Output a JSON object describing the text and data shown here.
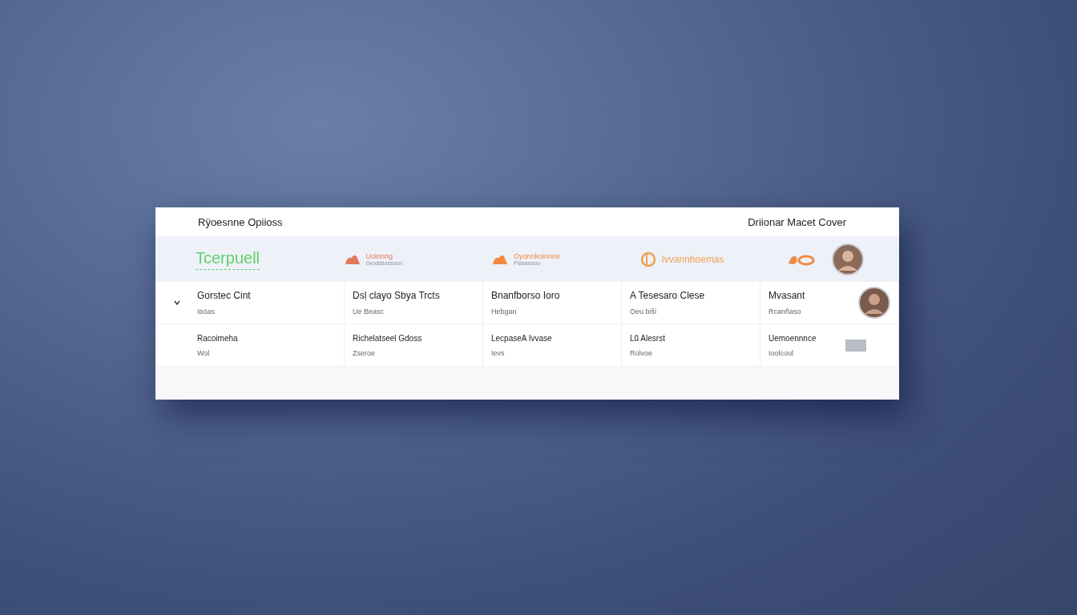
{
  "header": {
    "title": "Rÿoesnne Opiioss",
    "right_title": "Driionar Macet Cover"
  },
  "logos": [
    {
      "kind": "wordmark",
      "name": "Tcerpuell",
      "color": "#5fd06a"
    },
    {
      "kind": "icon_text",
      "name": "Uoinnng",
      "tagline": "Grodsbossoon",
      "color": "#e07a5a"
    },
    {
      "kind": "icon_text",
      "name": "Oyonnkoinnne",
      "tagline": "Piseanooo",
      "color": "#f08a40"
    },
    {
      "kind": "ring_text",
      "name": "Ivvannhoemas",
      "color": "#f0a050"
    },
    {
      "kind": "mark",
      "color": "#f08a40"
    }
  ],
  "rows": [
    {
      "expanded": true,
      "cells": [
        {
          "title": "Gorstec Cint",
          "subtitle": "Iɒöas"
        },
        {
          "title": "Dsḷ clayo Sbya Trcts",
          "subtitle": "Ue Beasc"
        },
        {
          "title": "Bnanfborso Ioro",
          "subtitle": "Hebgan"
        },
        {
          "title": "A Tesesaro Clese",
          "subtitle": "Oeu biši"
        },
        {
          "title": "Mvasant",
          "subtitle": "Rcanñaso"
        }
      ]
    },
    {
      "expanded": false,
      "cells": [
        {
          "title": "Racoimeha",
          "subtitle": "Wol"
        },
        {
          "title": "Richelatseel Gdoss",
          "subtitle": "Zseroe"
        },
        {
          "title": "LecpaseA Ivvase",
          "subtitle": "Ievs"
        },
        {
          "title": "Lŭ Alesrst",
          "subtitle": "Rolvoe"
        },
        {
          "title": "Uemoennnce",
          "subtitle": "Ioolcoul"
        }
      ]
    }
  ]
}
